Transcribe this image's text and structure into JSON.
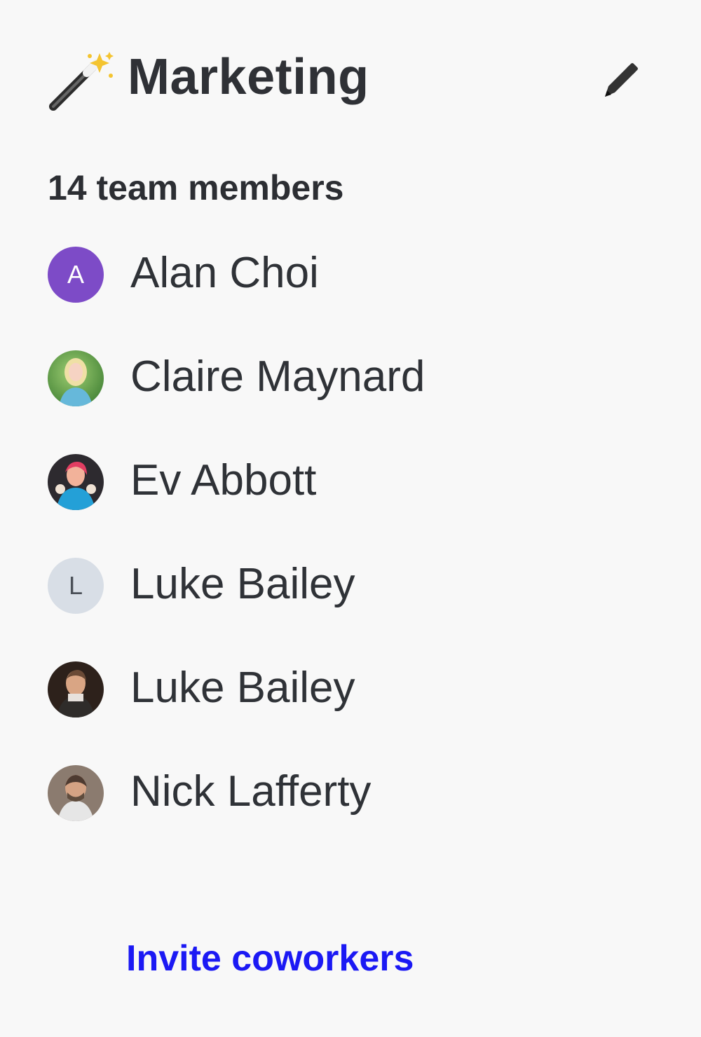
{
  "team": {
    "title": "Marketing",
    "icon": "magic-wand-icon",
    "edit_icon": "pencil-icon",
    "member_count_label": "14 team members"
  },
  "members": [
    {
      "name": "Alan Choi",
      "avatar_type": "initial",
      "initial": "A",
      "avatar_bg": "#7d4bc7",
      "avatar_fg": "#ffffff"
    },
    {
      "name": "Claire Maynard",
      "avatar_type": "photo",
      "avatar_icon": "photo-avatar"
    },
    {
      "name": "Ev Abbott",
      "avatar_type": "photo",
      "avatar_icon": "photo-avatar"
    },
    {
      "name": "Luke Bailey",
      "avatar_type": "initial",
      "initial": "L",
      "avatar_bg": "#d8dee6",
      "avatar_fg": "#4a4f57"
    },
    {
      "name": "Luke Bailey",
      "avatar_type": "photo",
      "avatar_icon": "photo-avatar"
    },
    {
      "name": "Nick Lafferty",
      "avatar_type": "photo",
      "avatar_icon": "photo-avatar"
    }
  ],
  "invite": {
    "label": "Invite coworkers"
  },
  "colors": {
    "background": "#f8f8f8",
    "text": "#2f3237",
    "link": "#1b19f4",
    "alan_avatar": "#7d4bc7",
    "luke_avatar": "#d8dee6"
  }
}
